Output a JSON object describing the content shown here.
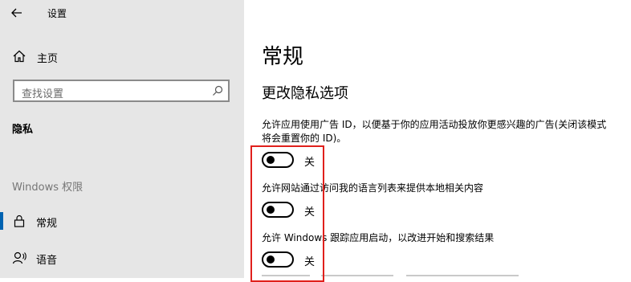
{
  "window": {
    "title": "设置"
  },
  "sidebar": {
    "home_label": "主页",
    "search": {
      "placeholder": "查找设置"
    },
    "section_heading": "隐私",
    "group_label": "Windows 权限",
    "items": [
      {
        "label": "常规",
        "icon": "lock-icon",
        "selected": true
      },
      {
        "label": "语音",
        "icon": "speech-icon",
        "selected": false
      }
    ]
  },
  "main": {
    "page_title": "常规",
    "subtitle": "更改隐私选项",
    "settings": [
      {
        "description": "允许应用使用广告 ID，以便基于你的应用活动投放你更感兴趣的广告(关闭该模式将会重置你的 ID)。",
        "toggle_state": "关",
        "on": false
      },
      {
        "description": "允许网站通过访问我的语言列表来提供本地相关内容",
        "toggle_state": "关",
        "on": false
      },
      {
        "description": "允许 Windows 跟踪应用启动，以改进开始和搜索结果",
        "toggle_state": "关",
        "on": false
      }
    ]
  },
  "colors": {
    "sidebar_bg": "#e6e6e6",
    "accent": "#0063b1",
    "annotation": "#e0201c"
  }
}
